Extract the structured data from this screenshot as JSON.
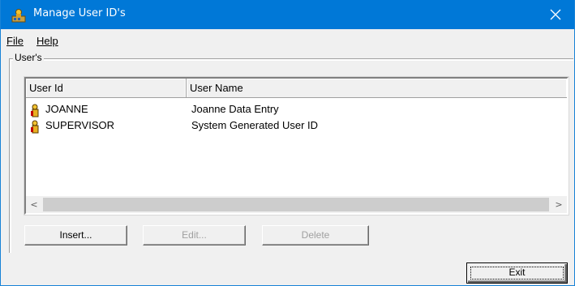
{
  "window": {
    "title": "Manage User ID's",
    "close_symbol": "✕"
  },
  "menu": {
    "file_label": "File",
    "help_label": "Help"
  },
  "group": {
    "label": "User's"
  },
  "list": {
    "columns": [
      "User Id",
      "User Name"
    ],
    "rows": [
      {
        "user_id": "JOANNE",
        "user_name": "Joanne Data Entry",
        "icon": "user-icon"
      },
      {
        "user_id": "SUPERVISOR",
        "user_name": "System Generated User ID",
        "icon": "user-icon"
      }
    ],
    "scroll_left": "<",
    "scroll_right": ">"
  },
  "buttons": {
    "insert_label": "Insert...",
    "edit_label": "Edit...",
    "delete_label": "Delete",
    "exit_label": "Exit"
  },
  "colors": {
    "titlebar": "#0078d7",
    "window_bg": "#f0f0f0"
  }
}
